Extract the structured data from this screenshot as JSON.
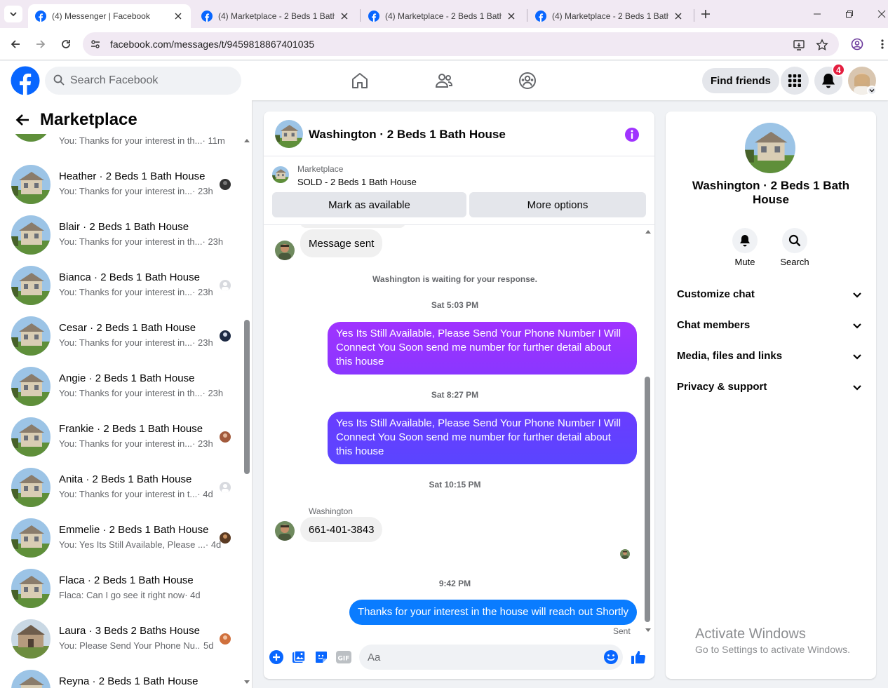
{
  "browser": {
    "tabs": [
      {
        "label": "(4) Messenger | Facebook",
        "active": true
      },
      {
        "label": "(4) Marketplace - 2 Beds 1 Bath",
        "active": false
      },
      {
        "label": "(4) Marketplace - 2 Beds 1 Bath",
        "active": false
      },
      {
        "label": "(4) Marketplace - 2 Beds 1 Bath",
        "active": false
      }
    ],
    "url": "facebook.com/messages/t/9459818867401035"
  },
  "header": {
    "search_placeholder": "Search Facebook",
    "find_friends": "Find friends",
    "notification_count": "4",
    "brand_color": "#0866ff"
  },
  "sidebar": {
    "title": "Marketplace",
    "conversations": [
      {
        "name": "",
        "preview": "You: Thanks for your interest in th...",
        "time": "· 11m"
      },
      {
        "name": "Heather · 2 Beds 1 Bath House",
        "preview": "You: Thanks for your interest in...",
        "time": "· 23h"
      },
      {
        "name": "Blair · 2 Beds 1 Bath House",
        "preview": "You: Thanks for your interest in th...",
        "time": "· 23h"
      },
      {
        "name": "Bianca · 2 Beds 1 Bath House",
        "preview": "You: Thanks for your interest in...",
        "time": "· 23h"
      },
      {
        "name": "Cesar · 2 Beds 1 Bath House",
        "preview": "You: Thanks for your interest in...",
        "time": "· 23h"
      },
      {
        "name": "Angie · 2 Beds 1 Bath House",
        "preview": "You: Thanks for your interest in th...",
        "time": "· 23h"
      },
      {
        "name": "Frankie · 2 Beds 1 Bath House",
        "preview": "You: Thanks for your interest in...",
        "time": "· 23h"
      },
      {
        "name": "Anita · 2 Beds 1 Bath House",
        "preview": "You: Thanks for your interest in t...",
        "time": "· 4d"
      },
      {
        "name": "Emmelie · 2 Beds 1 Bath House",
        "preview": "You: Yes Its Still Available, Please ...",
        "time": "· 4d"
      },
      {
        "name": "Flaca · 2 Beds 1 Bath House",
        "preview": "Flaca: Can I go see it right now",
        "time": "· 4d"
      },
      {
        "name": "Laura · 3 Beds 2 Baths House",
        "preview": "You: Please Send Your Phone Nu...",
        "time": "5d"
      },
      {
        "name": "Reyna · 2 Beds 1 Bath House",
        "preview": "",
        "time": ""
      }
    ]
  },
  "chat": {
    "title": "Washington · 2 Beds 1 Bath House",
    "marketplace_label": "Marketplace",
    "listing_status": "SOLD - 2 Beds 1 Bath House",
    "mark_available": "Mark as available",
    "more_options": "More options",
    "messages": {
      "received_1": "Message sent",
      "system": "Washington is waiting for your response.",
      "ts_1": "Sat 5:03 PM",
      "sent_1": "Yes Its Still Available, Please Send Your Phone Number I Will Connect You Soon      send me number for further detail about this house",
      "ts_2": "Sat 8:27 PM",
      "sent_2": "Yes Its Still Available, Please Send Your Phone Number I Will Connect You Soon      send me number for further detail about this house",
      "ts_3": "Sat 10:15 PM",
      "sender_name": "Washington",
      "received_2": "661-401-3843",
      "ts_4": "9:42 PM",
      "sent_3": "Thanks for your interest in the house will reach out Shortly",
      "sent_status": "Sent"
    },
    "composer_placeholder": "Aa",
    "colors": {
      "gradient_top": "#a033ff",
      "gradient_mid": "#6a3cff",
      "accent_blue": "#0a7cff",
      "composer_icon": "#0866ff"
    }
  },
  "info_panel": {
    "name": "Washington · 2 Beds 1 Bath House",
    "mute": "Mute",
    "search": "Search",
    "rows": [
      "Customize chat",
      "Chat members",
      "Media, files and links",
      "Privacy & support"
    ]
  },
  "watermark": {
    "line1": "Activate Windows",
    "line2": "Go to Settings to activate Windows."
  }
}
